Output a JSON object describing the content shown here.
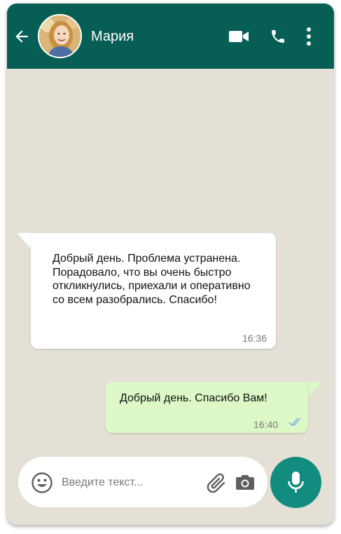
{
  "header": {
    "contact_name": "Мария",
    "back_icon": "arrow-left-icon",
    "video_icon": "video-camera-icon",
    "call_icon": "phone-icon",
    "menu_icon": "more-vertical-icon",
    "color": "#075e54"
  },
  "messages": [
    {
      "direction": "incoming",
      "text": "Добрый день. Проблема устранена. Порадовало, что вы очень быстро откликнулись, приехали и оперативно со всем разобрались. Спасибо!",
      "time": "16:36",
      "color": "#ffffff"
    },
    {
      "direction": "outgoing",
      "text": "Добрый день. Спасибо Вам!",
      "time": "16:40",
      "status_icon": "double-check-icon",
      "color": "#dcf8c6"
    }
  ],
  "composer": {
    "placeholder": "Введите текст...",
    "emoji_icon": "emoji-icon",
    "attach_icon": "paperclip-icon",
    "camera_icon": "camera-icon",
    "mic_icon": "microphone-icon",
    "mic_button_color": "#128c7e"
  },
  "chat_background_color": "#e4e0d5"
}
